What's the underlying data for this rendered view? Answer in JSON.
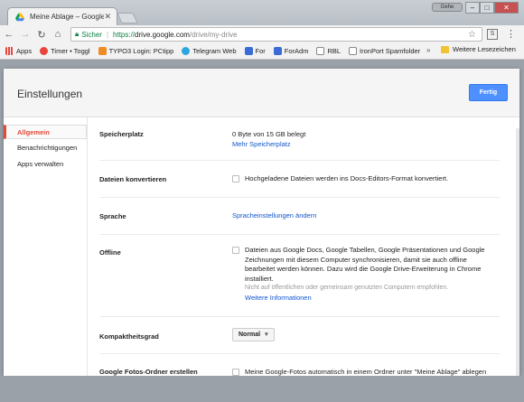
{
  "browser": {
    "tab_title": "Meine Ablage – Google D",
    "user_badge": "Gehe",
    "address": {
      "secure_label": "Sicher",
      "protocol": "https://",
      "host": "drive.google.com",
      "path": "/drive/my-drive"
    },
    "bookmarks": [
      {
        "label": "Apps",
        "color": "#e8453c"
      },
      {
        "label": "Timer • Toggl",
        "color": "#e8453c"
      },
      {
        "label": "TYPO3 Login: PCtipp",
        "color": "#f08a24"
      },
      {
        "label": "Telegram Web",
        "color": "#2ca5e0"
      },
      {
        "label": "For",
        "color": "#3b6bd6"
      },
      {
        "label": "ForAdm",
        "color": "#3b6bd6"
      },
      {
        "label": "RBL",
        "color": "#888888"
      },
      {
        "label": "IronPort Spamfolder",
        "color": "#888888"
      }
    ],
    "bookmarks_more": "»",
    "other_bookmarks": "Weitere Lesezeichen"
  },
  "dialog": {
    "title": "Einstellungen",
    "done_label": "Fertig",
    "sidebar": [
      {
        "label": "Allgemein",
        "active": true
      },
      {
        "label": "Benachrichtigungen",
        "active": false
      },
      {
        "label": "Apps verwalten",
        "active": false
      }
    ],
    "storage": {
      "label": "Speicherplatz",
      "value": "0 Byte von 15 GB belegt",
      "link": "Mehr Speicherplatz"
    },
    "convert": {
      "label": "Dateien konvertieren",
      "text": "Hochgeladene Dateien werden ins Docs-Editors-Format konvertiert."
    },
    "language": {
      "label": "Sprache",
      "link": "Spracheinstellungen ändern"
    },
    "offline": {
      "label": "Offline",
      "text": "Dateien aus Google Docs, Google Tabellen, Google Präsentationen und Google Zeichnungen mit diesem Computer synchronisieren, damit sie auch offline bearbeitet werden können. Dazu wird die Google Drive-Erweiterung in Chrome installiert.",
      "note": "Nicht auf öffentlichen oder gemeinsam genutzten Computern empfohlen.",
      "link": "Weitere Informationen"
    },
    "density": {
      "label": "Kompaktheitsgrad",
      "value": "Normal"
    },
    "photos": {
      "label": "Google Fotos-Ordner erstellen",
      "text": "Meine Google-Fotos automatisch in einem Ordner unter \"Meine Ablage\" ablegen"
    }
  }
}
